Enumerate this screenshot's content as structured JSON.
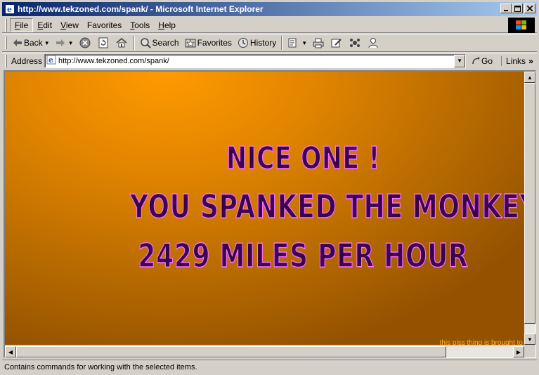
{
  "window": {
    "title": "http://www.tekzoned.com/spank/ - Microsoft Internet Explorer",
    "minimize": "_",
    "maximize": "□",
    "close": "×"
  },
  "menu": {
    "items": [
      {
        "key": "F",
        "rest": "ile"
      },
      {
        "key": "E",
        "rest": "dit"
      },
      {
        "key": "V",
        "rest": "iew"
      },
      {
        "key": "F",
        "rest": "avorites",
        "prefix": ""
      },
      {
        "key": "T",
        "rest": "ools"
      },
      {
        "key": "H",
        "rest": "elp"
      }
    ]
  },
  "toolbar": {
    "back_label": "Back",
    "search_label": "Search",
    "favorites_label": "Favorites",
    "history_label": "History"
  },
  "address": {
    "label": "Address",
    "url": "http://www.tekzoned.com/spank/",
    "go_label": "Go",
    "links_label": "Links",
    "links_chevron": "»"
  },
  "page": {
    "line1": "NICE ONE !",
    "line2": "YOU SPANKED THE MONKEY AT",
    "line3": "2429 MILES PER HOUR",
    "credit": "this piss thing is brought to"
  },
  "status": {
    "text": "Contains commands for working with the selected items."
  }
}
